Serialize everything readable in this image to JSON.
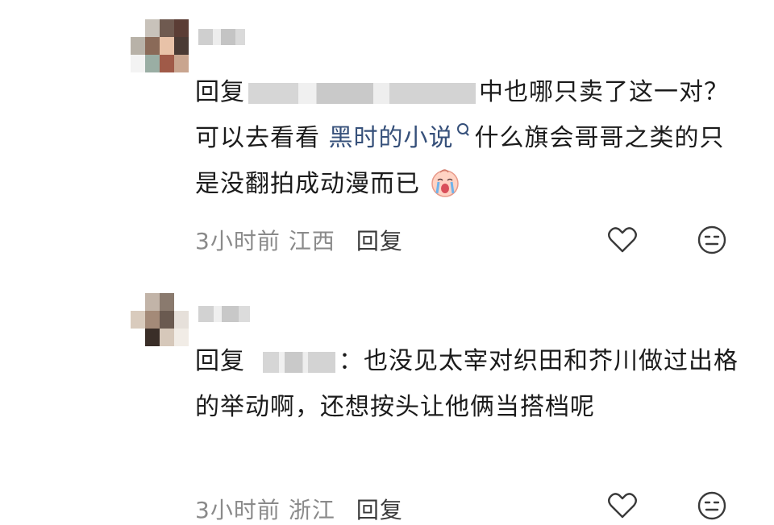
{
  "comments": [
    {
      "reply_prefix": "回复",
      "text_after_mention": "中也哪只卖了这一对？可以去看看",
      "link_text": "黑时的小说",
      "text_after_link": "什么旗会哥哥之类的只是没翻拍成动漫而已",
      "time": "3小时前",
      "location": "江西",
      "reply_label": "回复",
      "emoji": "crying-baby-emoji"
    },
    {
      "reply_prefix": "回复",
      "text_after_mention": "：也没见太宰对织田和芥川做过出格的举动啊，还想按头让他俩当搭档呢",
      "time": "3小时前",
      "location": "浙江",
      "reply_label": "回复"
    }
  ],
  "icons": {
    "like": "heart-outline-icon",
    "dislike": "neutral-face-icon",
    "link_search": "search-icon"
  },
  "colors": {
    "link": "#36507a",
    "meta": "#8a8a8a",
    "text": "#1b1b1b"
  }
}
